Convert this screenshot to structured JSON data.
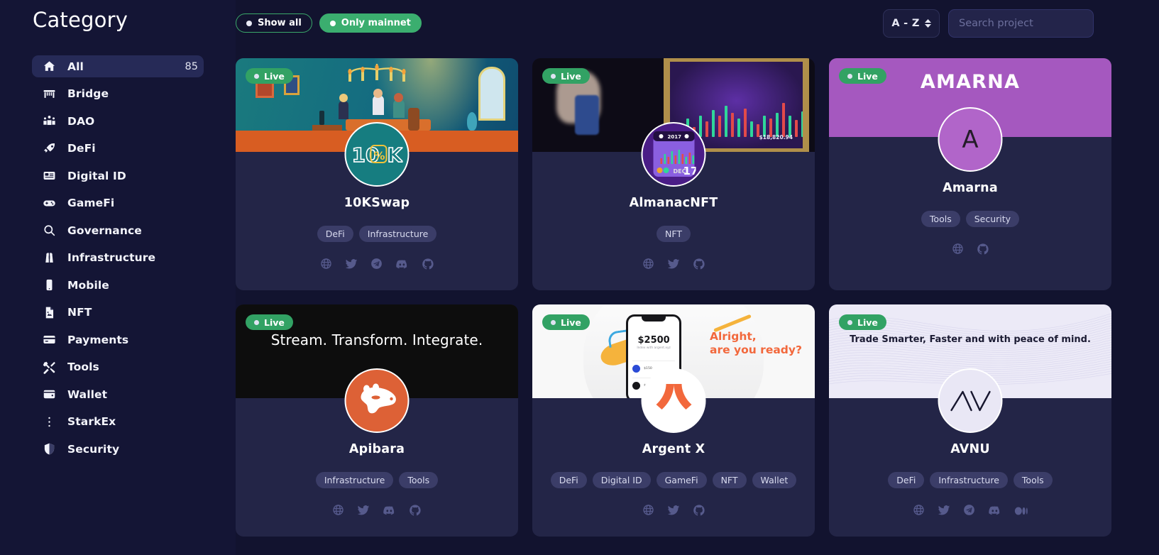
{
  "sidebar": {
    "title": "Category",
    "items": [
      {
        "label": "All",
        "icon": "home-icon",
        "count": "85",
        "active": true
      },
      {
        "label": "Bridge",
        "icon": "bridge-icon",
        "count": "",
        "active": false
      },
      {
        "label": "DAO",
        "icon": "people-icon",
        "count": "",
        "active": false
      },
      {
        "label": "DeFi",
        "icon": "rocket-icon",
        "count": "",
        "active": false
      },
      {
        "label": "Digital ID",
        "icon": "id-card-icon",
        "count": "",
        "active": false
      },
      {
        "label": "GameFi",
        "icon": "gamepad-icon",
        "count": "",
        "active": false
      },
      {
        "label": "Governance",
        "icon": "search-icon",
        "count": "",
        "active": false
      },
      {
        "label": "Infrastructure",
        "icon": "binoculars-icon",
        "count": "",
        "active": false
      },
      {
        "label": "Mobile",
        "icon": "phone-icon",
        "count": "",
        "active": false
      },
      {
        "label": "NFT",
        "icon": "image-file-icon",
        "count": "",
        "active": false
      },
      {
        "label": "Payments",
        "icon": "credit-card-icon",
        "count": "",
        "active": false
      },
      {
        "label": "Tools",
        "icon": "tools-icon",
        "count": "",
        "active": false
      },
      {
        "label": "Wallet",
        "icon": "wallet-icon",
        "count": "",
        "active": false
      },
      {
        "label": "StarkEx",
        "icon": "dots-vertical-icon",
        "count": "",
        "active": false
      },
      {
        "label": "Security",
        "icon": "shield-icon",
        "count": "",
        "active": false
      }
    ]
  },
  "toolbar": {
    "filters": [
      {
        "label": "Show all",
        "style": "outline"
      },
      {
        "label": "Only mainnet",
        "style": "filled"
      }
    ],
    "sort_label": "A - Z",
    "search_placeholder": "Search project",
    "search_value": ""
  },
  "colors": {
    "page_bg": "#12132f",
    "sidebar_bg": "#141535",
    "card_bg": "#232547",
    "accent_green": "#3bae6f",
    "active_nav_bg": "#262a57",
    "tag_bg": "#3b3d68"
  },
  "cards": [
    {
      "name": "10KSwap",
      "status": "Live",
      "banner_style": "10k",
      "banner_text": "",
      "logo_text": "10K",
      "tags": [
        "DeFi",
        "Infrastructure"
      ],
      "socials": [
        "globe-icon",
        "twitter-icon",
        "telegram-icon",
        "discord-icon",
        "github-icon"
      ]
    },
    {
      "name": "AlmanacNFT",
      "status": "Live",
      "banner_style": "almanac",
      "banner_text": "$18,820.94",
      "logo_text": "DEC 17",
      "tags": [
        "NFT"
      ],
      "socials": [
        "globe-icon",
        "twitter-icon",
        "github-icon"
      ]
    },
    {
      "name": "Amarna",
      "status": "Live",
      "banner_style": "amarna",
      "banner_text": "AMARNA",
      "logo_text": "A",
      "tags": [
        "Tools",
        "Security"
      ],
      "socials": [
        "globe-icon",
        "github-icon"
      ]
    },
    {
      "name": "Apibara",
      "status": "Live",
      "banner_style": "apibara",
      "banner_text": "Stream. Transform. Integrate.",
      "logo_text": "",
      "tags": [
        "Infrastructure",
        "Tools"
      ],
      "socials": [
        "globe-icon",
        "twitter-icon",
        "discord-icon",
        "github-icon"
      ]
    },
    {
      "name": "Argent X",
      "status": "Live",
      "banner_style": "argent",
      "banner_text": "Alright,\nare you ready?",
      "banner_amount": "$2500",
      "logo_text": "",
      "tags": [
        "DeFi",
        "Digital ID",
        "GameFi",
        "NFT",
        "Wallet"
      ],
      "socials": [
        "globe-icon",
        "twitter-icon",
        "github-icon"
      ]
    },
    {
      "name": "AVNU",
      "status": "Live",
      "banner_style": "avnu",
      "banner_text": "Trade Smarter, Faster and with peace of mind.",
      "logo_text": "AV",
      "tags": [
        "DeFi",
        "Infrastructure",
        "Tools"
      ],
      "socials": [
        "globe-icon",
        "twitter-icon",
        "telegram-icon",
        "discord-icon",
        "medium-icon"
      ]
    }
  ]
}
